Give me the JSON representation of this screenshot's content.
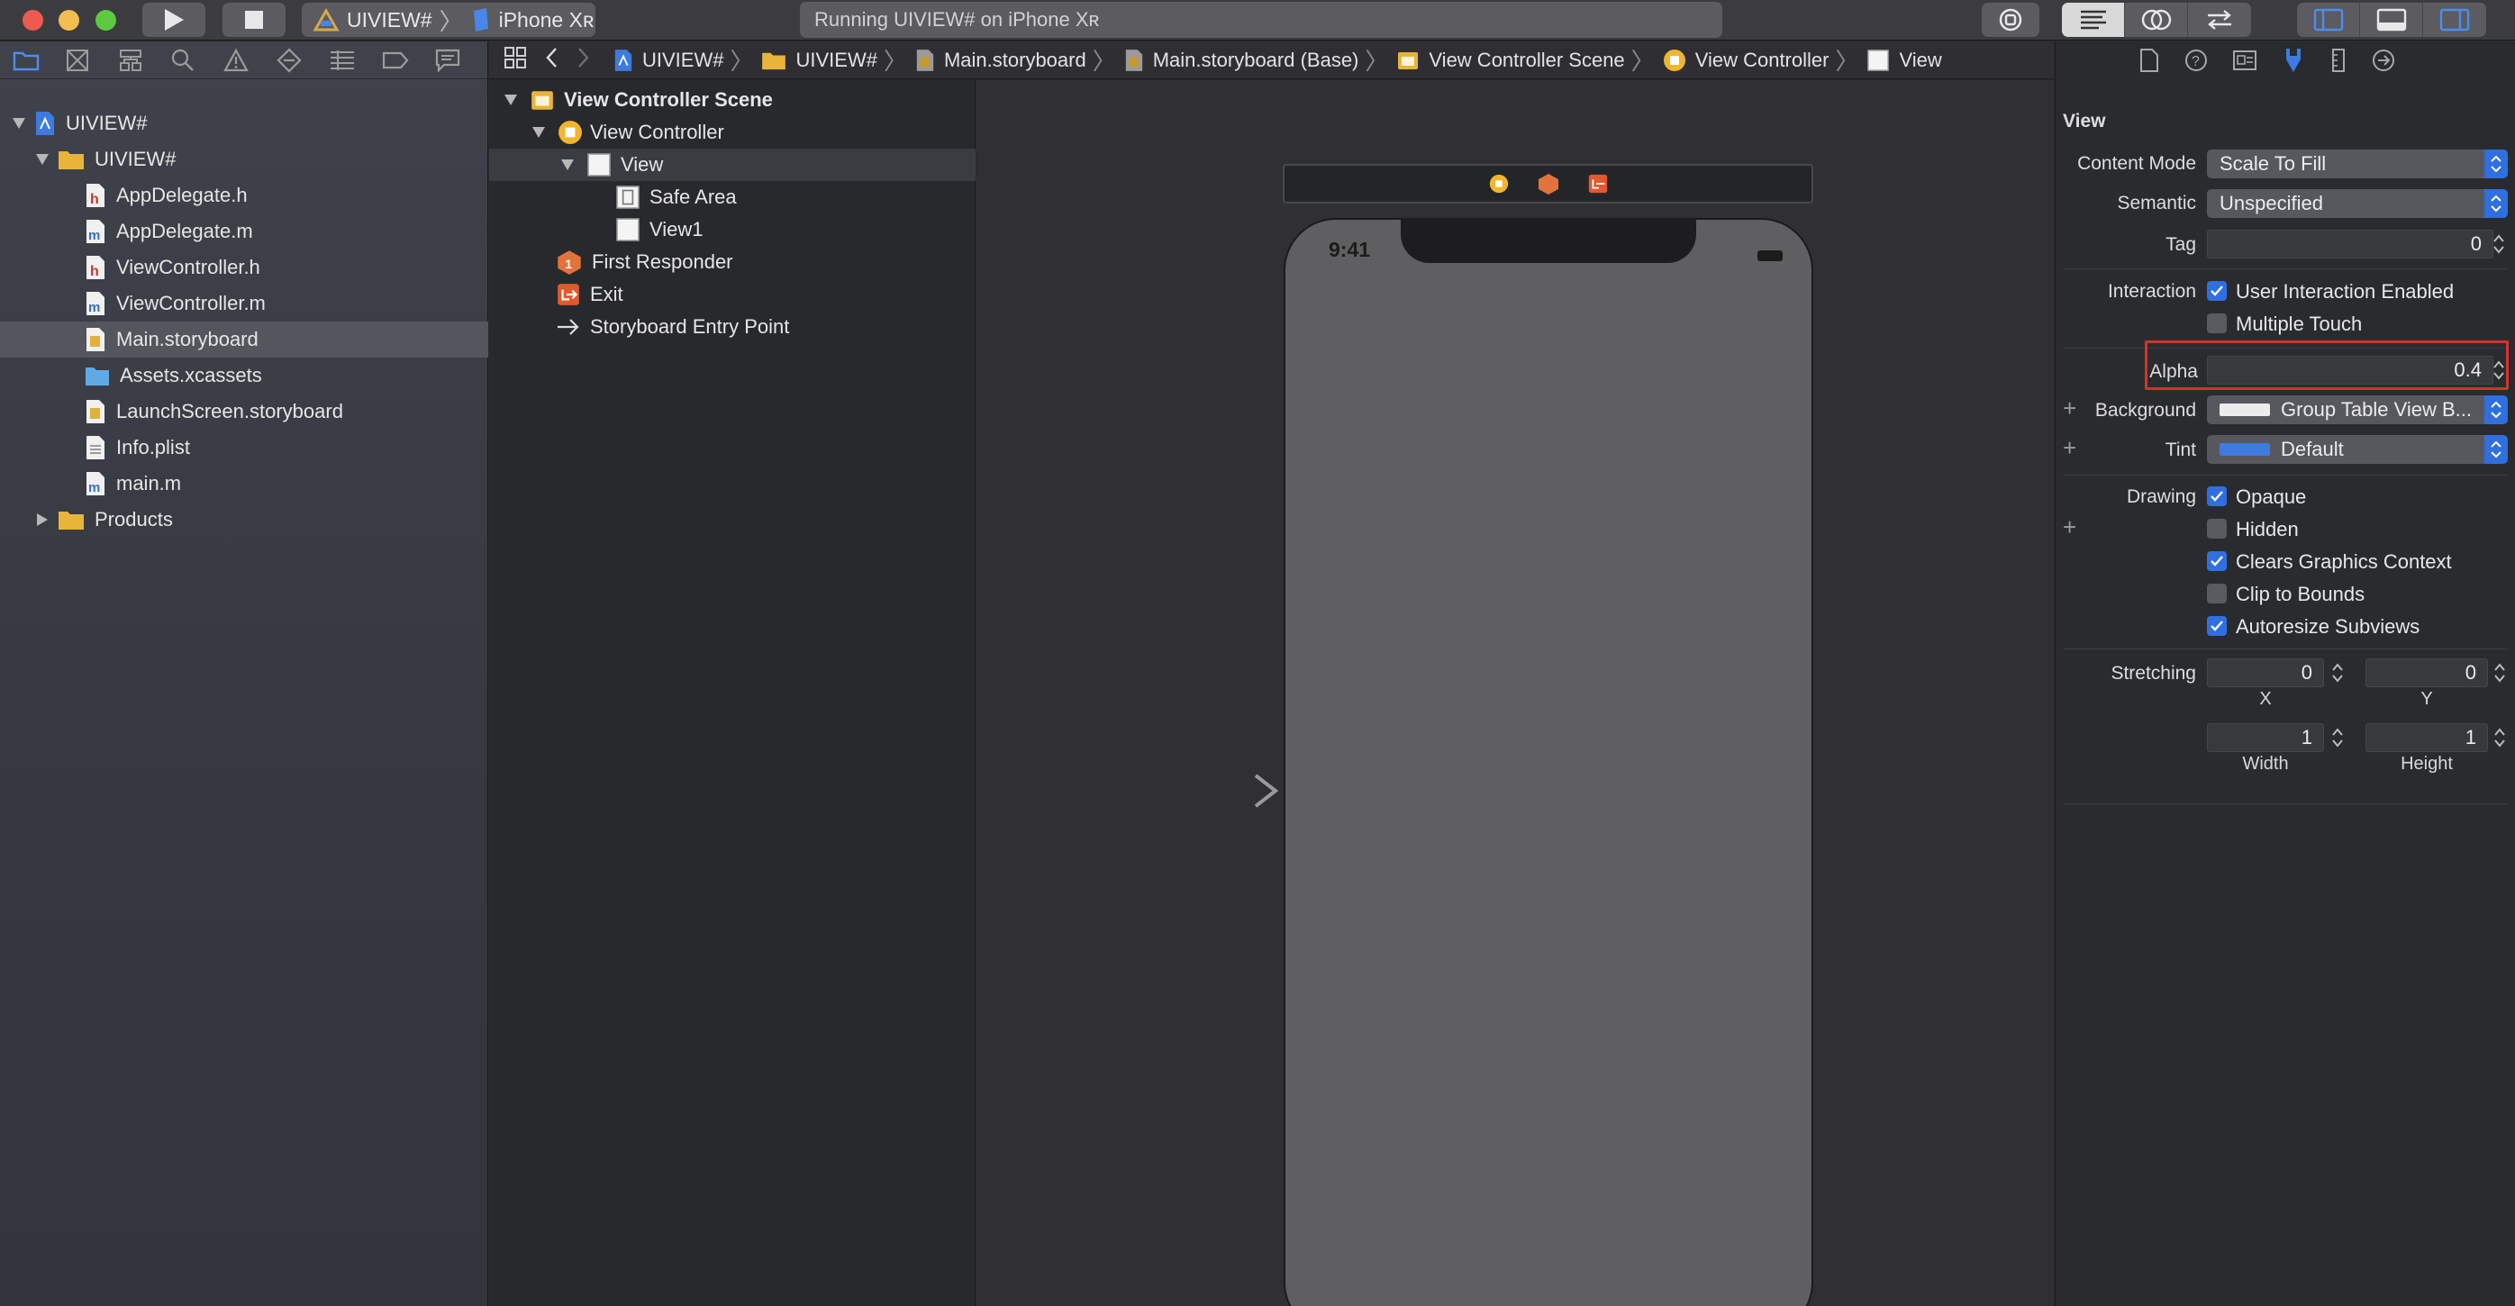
{
  "toolbar": {
    "scheme_project": "UIVIEW#",
    "scheme_device": "iPhone Xʀ",
    "status": "Running UIVIEW# on iPhone Xʀ",
    "colors": {
      "close": "#ee5a52",
      "minimize": "#f4bd4f",
      "zoom": "#5ec840"
    }
  },
  "navigator": {
    "tab_icons": [
      "folder-icon",
      "source-control-icon",
      "hierarchy-icon",
      "search-icon",
      "warning-icon",
      "test-icon",
      "debug-icon",
      "breakpoint-icon",
      "report-icon"
    ],
    "items": [
      {
        "label": "UIVIEW#",
        "kind": "project",
        "level": 0,
        "expanded": true
      },
      {
        "label": "UIVIEW#",
        "kind": "folder",
        "level": 1,
        "expanded": true
      },
      {
        "label": "AppDelegate.h",
        "kind": "h",
        "level": 2
      },
      {
        "label": "AppDelegate.m",
        "kind": "m",
        "level": 2
      },
      {
        "label": "ViewController.h",
        "kind": "h",
        "level": 2
      },
      {
        "label": "ViewController.m",
        "kind": "m",
        "level": 2
      },
      {
        "label": "Main.storyboard",
        "kind": "storyboard",
        "level": 2,
        "selected": true
      },
      {
        "label": "Assets.xcassets",
        "kind": "assets",
        "level": 2
      },
      {
        "label": "LaunchScreen.storyboard",
        "kind": "storyboard",
        "level": 2
      },
      {
        "label": "Info.plist",
        "kind": "plist",
        "level": 2
      },
      {
        "label": "main.m",
        "kind": "m",
        "level": 2
      },
      {
        "label": "Products",
        "kind": "folder",
        "level": 1,
        "expanded": false
      }
    ]
  },
  "jumpbar": {
    "crumbs": [
      "UIVIEW#",
      "UIVIEW#",
      "Main.storyboard",
      "Main.storyboard (Base)",
      "View Controller Scene",
      "View Controller",
      "View"
    ]
  },
  "outline": {
    "items": [
      {
        "label": "View Controller Scene",
        "level": 0,
        "bold": true
      },
      {
        "label": "View Controller",
        "level": 1
      },
      {
        "label": "View",
        "level": 2,
        "selected": true
      },
      {
        "label": "Safe Area",
        "level": 3
      },
      {
        "label": "View1",
        "level": 3
      },
      {
        "label": "First Responder",
        "level": 1
      },
      {
        "label": "Exit",
        "level": 1
      },
      {
        "label": "Storyboard Entry Point",
        "level": 1
      }
    ]
  },
  "canvas": {
    "clock": "9:41"
  },
  "inspector": {
    "section_title": "View",
    "content_mode_label": "Content Mode",
    "content_mode": "Scale To Fill",
    "semantic_label": "Semantic",
    "semantic": "Unspecified",
    "tag_label": "Tag",
    "tag": "0",
    "interaction_label": "Interaction",
    "user_interaction": {
      "label": "User Interaction Enabled",
      "checked": true
    },
    "multiple_touch": {
      "label": "Multiple Touch",
      "checked": false
    },
    "alpha_label": "Alpha",
    "alpha": "0.4",
    "background_label": "Background",
    "background": "Group Table View B...",
    "tint_label": "Tint",
    "tint": "Default",
    "drawing_label": "Drawing",
    "opaque": {
      "label": "Opaque",
      "checked": true
    },
    "hidden": {
      "label": "Hidden",
      "checked": false
    },
    "clears_context": {
      "label": "Clears Graphics Context",
      "checked": true
    },
    "clip_bounds": {
      "label": "Clip to Bounds",
      "checked": false
    },
    "autoresize": {
      "label": "Autoresize Subviews",
      "checked": true
    },
    "stretching_label": "Stretching",
    "stretch_x": "0",
    "stretch_y": "0",
    "x_label": "X",
    "y_label": "Y",
    "stretch_w": "1",
    "stretch_h": "1",
    "width_label": "Width",
    "height_label": "Height",
    "accent": "#2f6fe0"
  }
}
